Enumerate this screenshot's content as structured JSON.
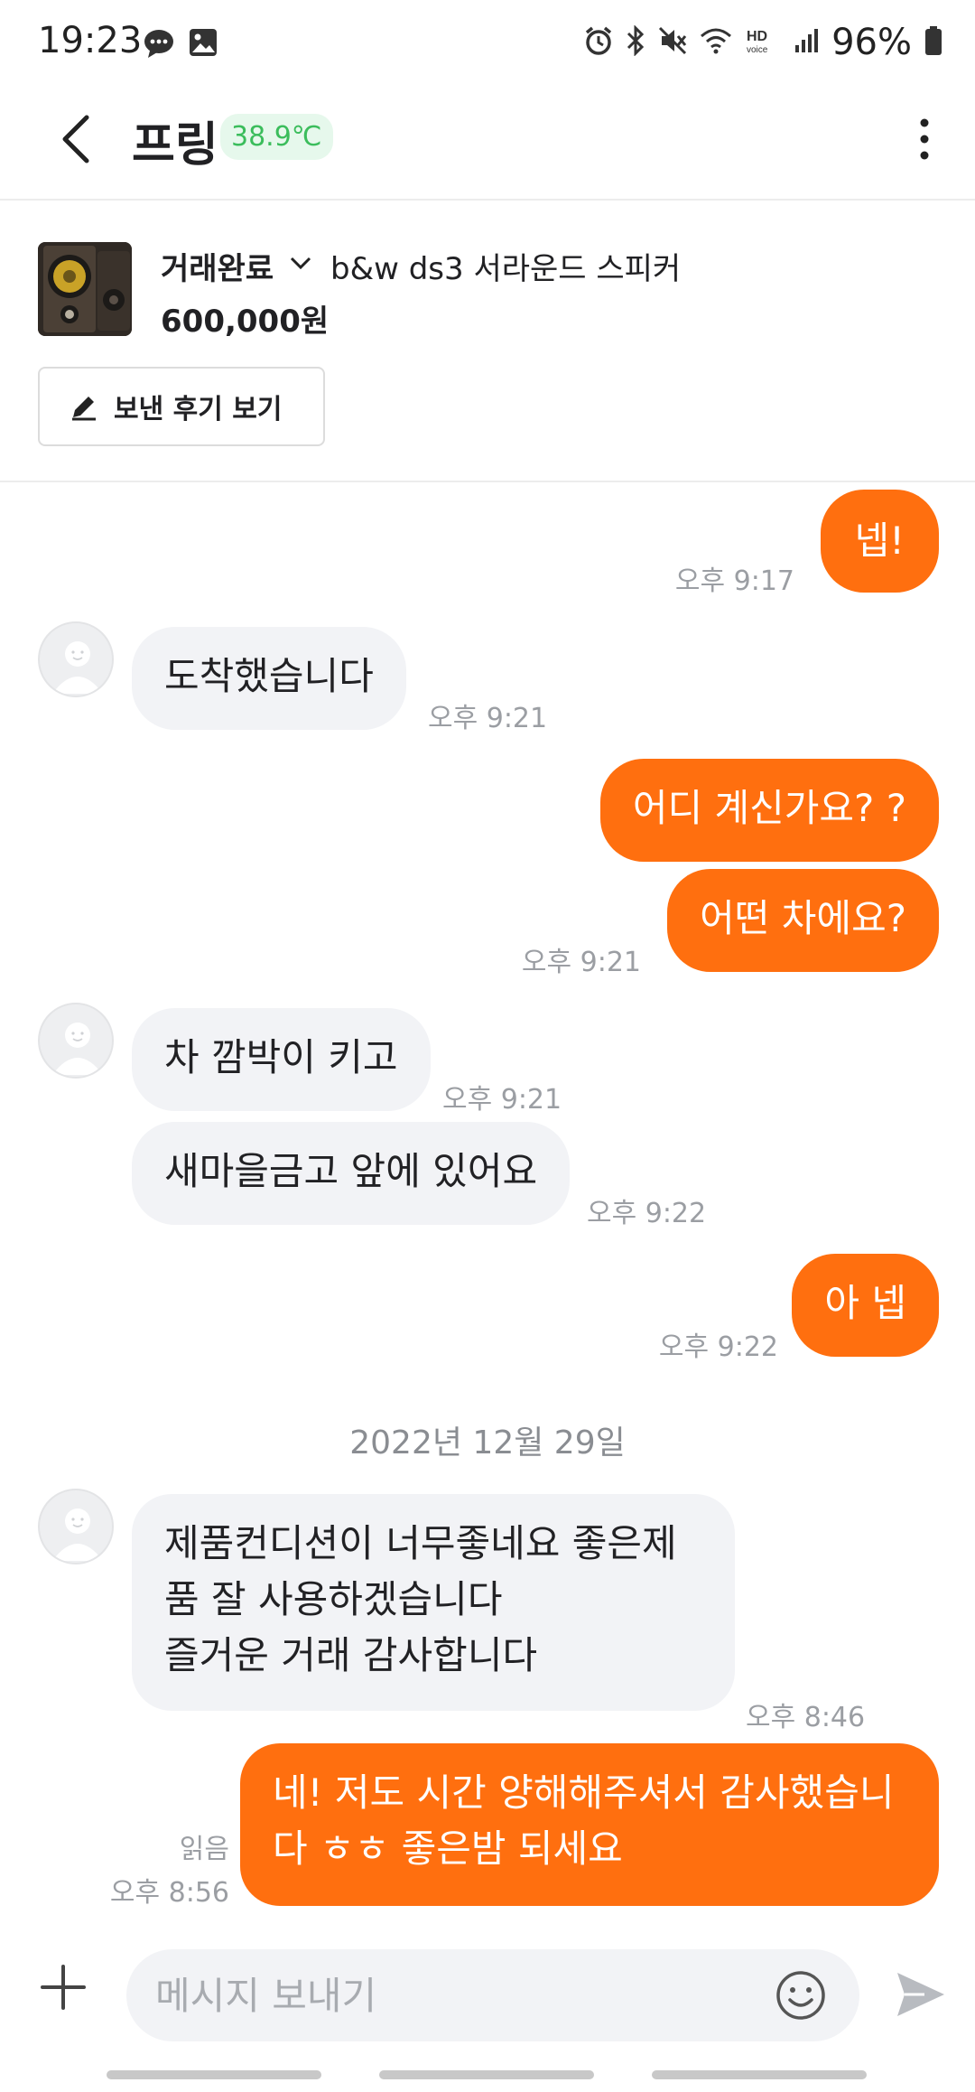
{
  "status_bar": {
    "time": "19:23",
    "battery": "96%"
  },
  "header": {
    "nickname": "프링",
    "temperature": "38.9℃"
  },
  "product": {
    "trade_status": "거래완료",
    "title": "b&w ds3 서라운드 스피커",
    "price": "600,000원",
    "review_button": "보낸 후기 보기"
  },
  "messages": [
    {
      "from": "me",
      "text": "넵!",
      "time": "오후 9:17"
    },
    {
      "from": "them",
      "text": "도착했습니다",
      "time": "오후 9:21"
    },
    {
      "from": "me",
      "text": "어디 계신가요? ?",
      "time": ""
    },
    {
      "from": "me",
      "text": "어떤 차에요?",
      "time": "오후 9:21"
    },
    {
      "from": "them",
      "text": "차 깜박이 키고",
      "time": "오후 9:21"
    },
    {
      "from": "them",
      "text": "새마을금고 앞에 있어요",
      "time": "오후 9:22"
    },
    {
      "from": "me",
      "text": "아 넵",
      "time": "오후 9:22"
    },
    {
      "from": "them",
      "text": "제품컨디션이 너무좋네요 좋은제\n품 잘 사용하겠습니다\n즐거운 거래 감사합니다",
      "time": "오후 8:46"
    },
    {
      "from": "me",
      "text": "네! 저도 시간 양해해주셔서 감사했습니\n다 ㅎㅎ 좋은밤 되세요",
      "time": "오후 8:56",
      "read": "읽음"
    }
  ],
  "date_divider": "2022년 12월 29일",
  "input": {
    "placeholder": "메시지 보내기"
  },
  "colors": {
    "accent": "#ff6f0f",
    "incoming_bubble": "#f2f3f6",
    "temperature_green": "#3bbd5c"
  },
  "icons": {
    "back": "chevron-left-icon",
    "more": "more-vertical-icon",
    "chevron": "chevron-down-icon",
    "pencil": "pencil-icon",
    "plus": "plus-icon",
    "emoji": "smile-icon",
    "send": "send-icon"
  }
}
